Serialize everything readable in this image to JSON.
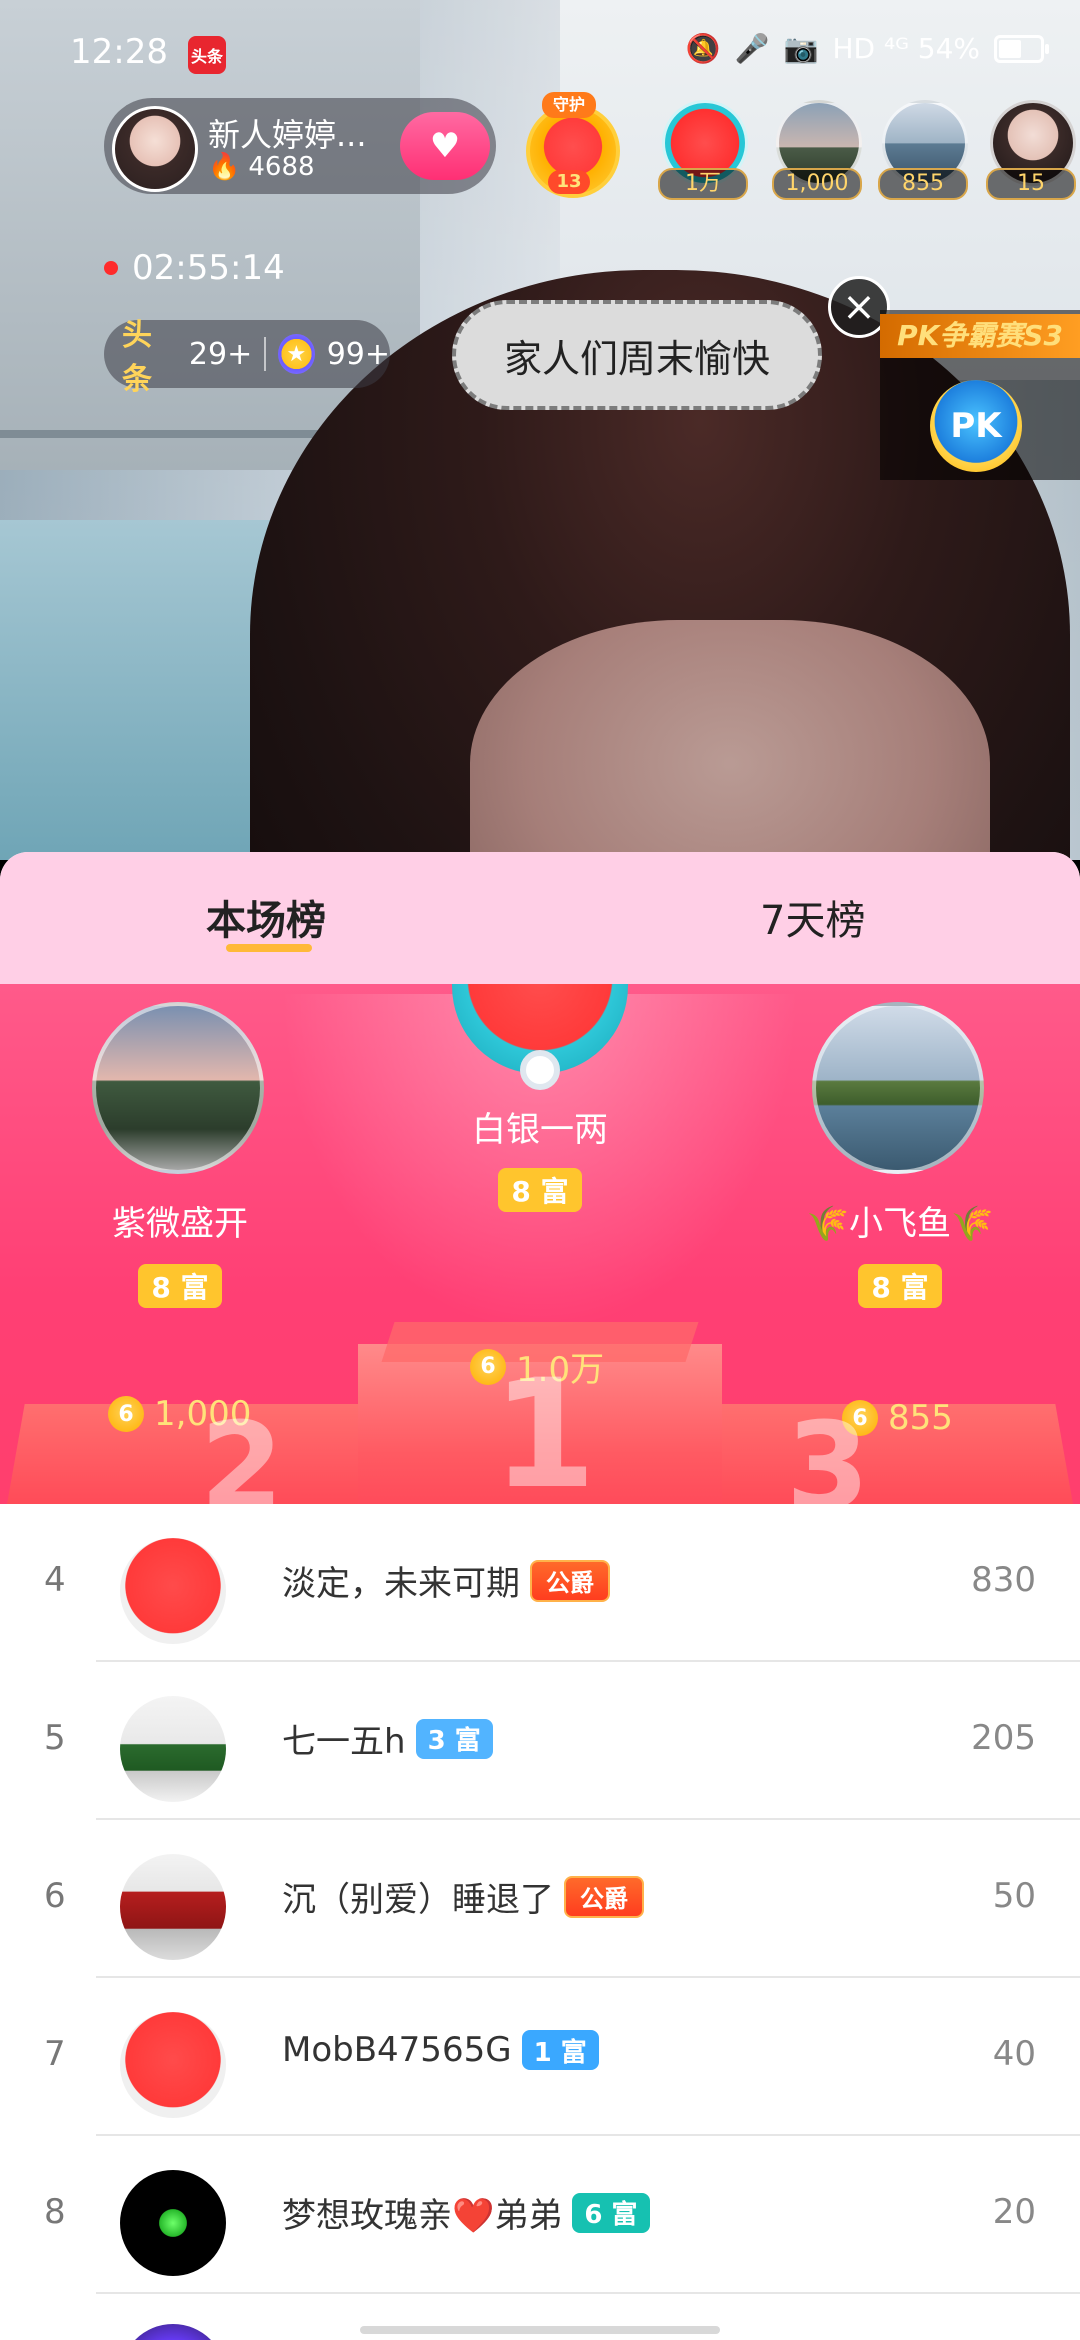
{
  "status_bar": {
    "time": "12:28",
    "app_icon_text": "头条",
    "right_text": "HD ⁴ᴳ 54%",
    "battery_percent": 54
  },
  "host": {
    "name": "新人婷婷...",
    "heat": "4688"
  },
  "top_badges": {
    "guardian_top": "守护",
    "guardian_level": "13",
    "viewers": [
      {
        "label": "1万"
      },
      {
        "label": "1,000"
      },
      {
        "label": "855"
      },
      {
        "label": "15"
      }
    ]
  },
  "live": {
    "timer": "02:55:14",
    "tag_left_brand": "头条",
    "tag_left_count": "29+",
    "tag_right_count": "99+"
  },
  "overlay": {
    "message": "家人们周末愉快",
    "pk_title": "PK争霸赛S3",
    "pk_badge": "PK"
  },
  "leaderboard": {
    "tabs": [
      {
        "label": "本场榜"
      },
      {
        "label": "7天榜"
      }
    ],
    "podium": {
      "first": {
        "name": "白银一两",
        "rich": "8 富",
        "amount": "1.0万",
        "rank": "1"
      },
      "second": {
        "name": "紫微盛开",
        "rich": "8 富",
        "amount": "1,000",
        "rank": "2"
      },
      "third": {
        "name": "🌾小飞鱼🌾",
        "rich": "8 富",
        "amount": "855",
        "rank": "3"
      }
    },
    "rows": [
      {
        "rank": "4",
        "name": "淡定，未来可期",
        "badge": "公爵",
        "score": "830"
      },
      {
        "rank": "5",
        "name": "七一五h",
        "badge": "3 富",
        "score": "205"
      },
      {
        "rank": "6",
        "name": "沉（别爱）睡退了",
        "badge": "公爵",
        "score": "50"
      },
      {
        "rank": "7",
        "name": "MobB47565G",
        "badge": "1 富",
        "score": "40"
      },
      {
        "rank": "8",
        "name": "梦想玫瑰亲❤️弟弟",
        "badge": "6 富",
        "score": "20"
      }
    ]
  }
}
